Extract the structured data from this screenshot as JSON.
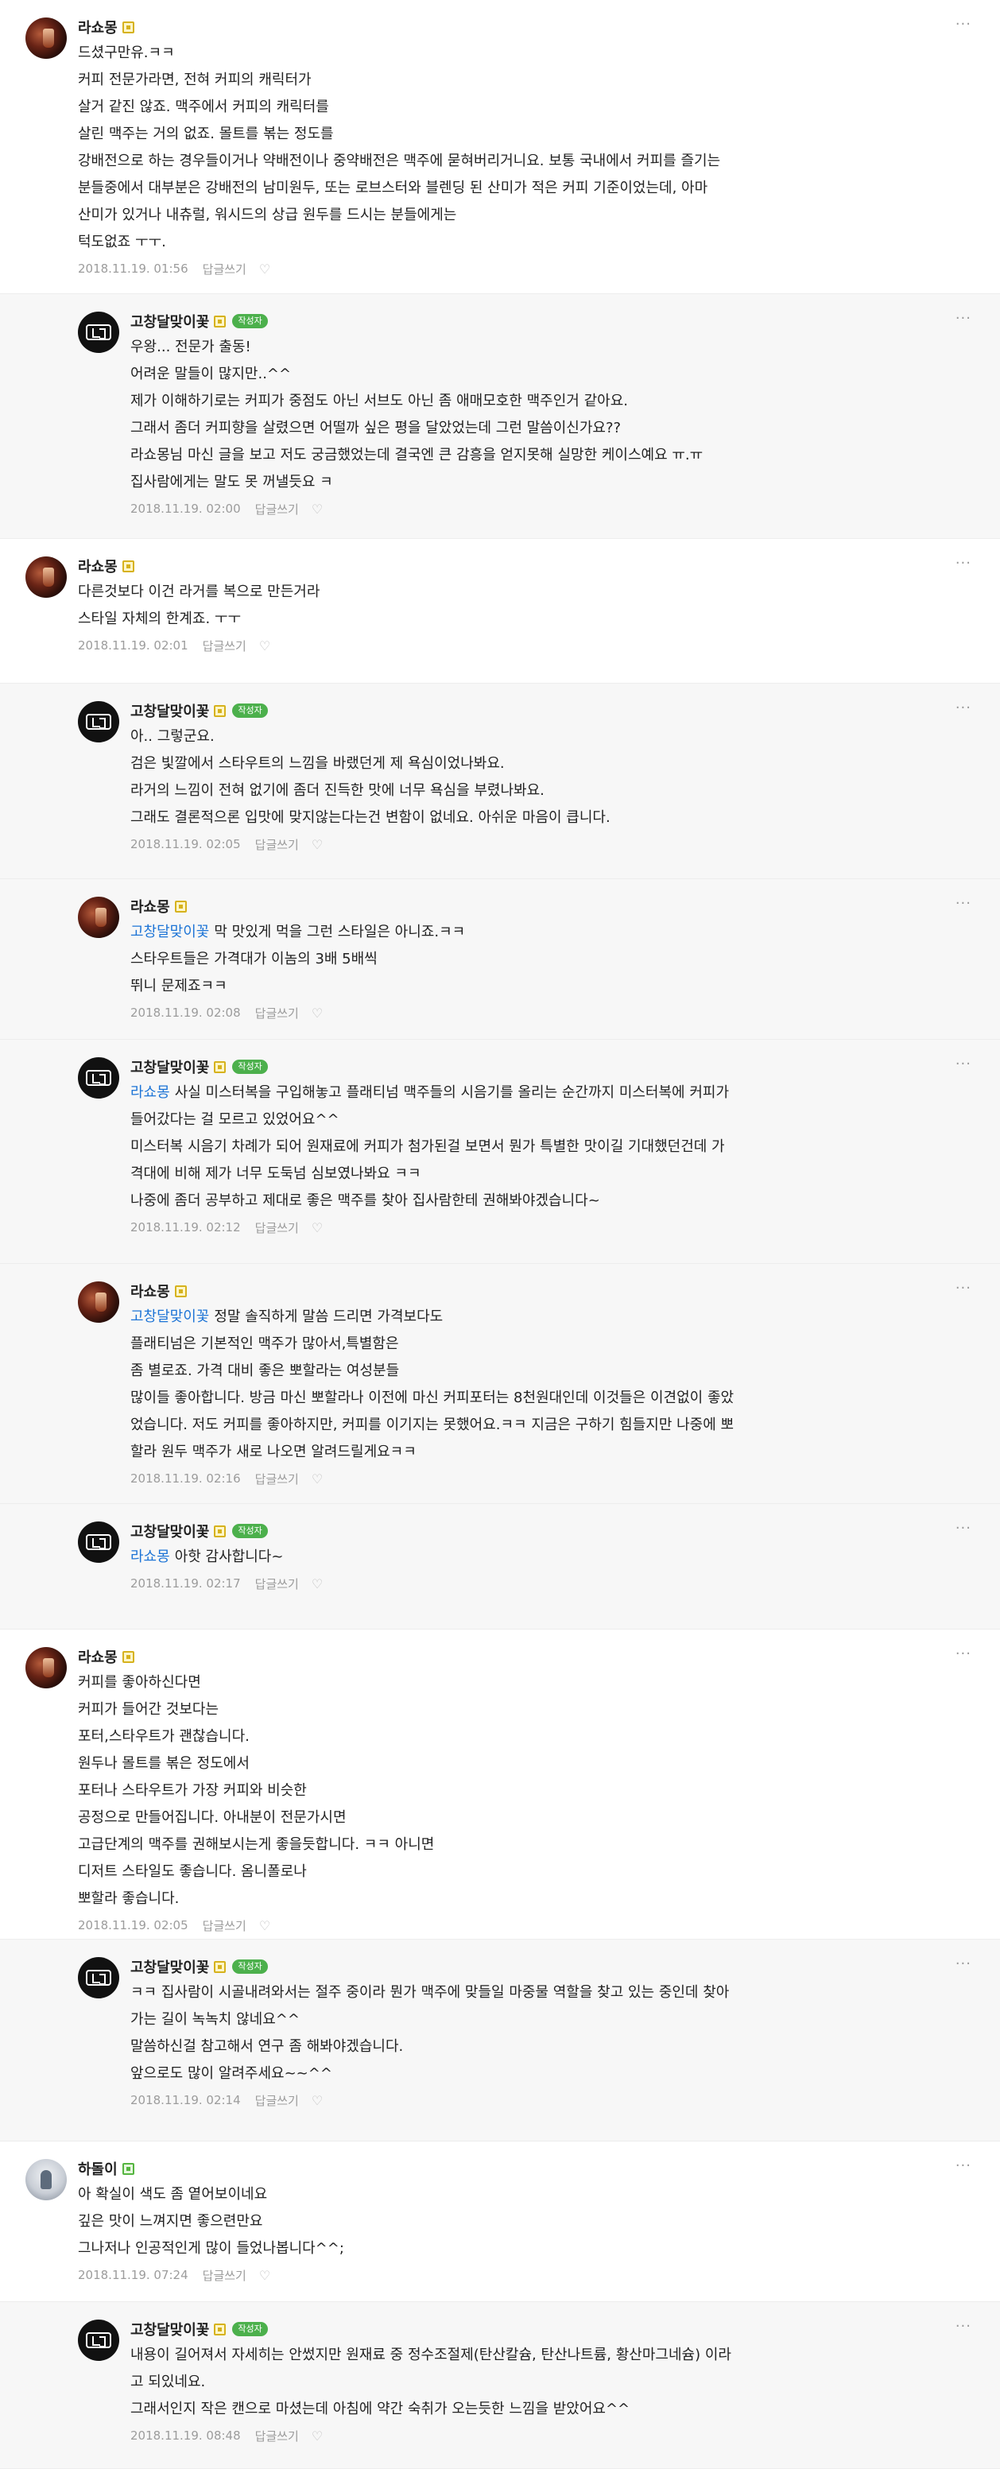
{
  "labels": {
    "reply": "답글쓰기",
    "author_badge": "작성자",
    "more": "···",
    "heart": "♡"
  },
  "comments": [
    {
      "avatar": "lasho",
      "nickname": "라쇼몽",
      "lines": [
        "드셨구만유.ㅋㅋ",
        "커피 전문가라면, 전혀 커피의 캐릭터가",
        "살거 같진 않죠. 맥주에서 커피의 캐릭터를",
        "살린 맥주는 거의 없죠. 몰트를 볶는 정도를",
        "강배전으로 하는 경우들이거나 약배전이나 중약배전은 맥주에 묻혀버리거니요. 보통 국내에서 커피를 즐기는",
        "분들중에서 대부분은 강배전의 남미원두, 또는 로브스터와 블렌딩 된 산미가 적은 커피 기준이었는데, 아마",
        "산미가 있거나 내츄럴, 워시드의 상급 원두를 드시는 분들에게는",
        "턱도없죠 ㅜㅜ."
      ],
      "date": "2018.11.19. 01:56"
    },
    {
      "avatar": "gosd",
      "nickname": "고창달맞이꽃",
      "is_author": true,
      "lines": [
        "우왕... 전문가 출동!",
        "어려운 말들이 많지만..^^",
        "제가 이해하기로는 커피가 중점도 아닌 서브도 아닌 좀 애매모호한 맥주인거 같아요.",
        "그래서 좀더 커피향을 살렸으면 어떨까 싶은 평을 달았었는데 그런 말씀이신가요??",
        "라쇼몽님 마신 글을 보고 저도 궁금했었는데 결국엔 큰 감흥을 얻지못해 실망한 케이스예요 ㅠ.ㅠ",
        "집사람에게는 말도 못 꺼낼듯요 ㅋ"
      ],
      "date": "2018.11.19. 02:00"
    },
    {
      "avatar": "lasho",
      "nickname": "라쇼몽",
      "lines": [
        "다른것보다 이건 라거를 복으로 만든거라",
        "스타일 자체의 한계죠. ㅜㅜ"
      ],
      "date": "2018.11.19. 02:01"
    },
    {
      "avatar": "gosd",
      "nickname": "고창달맞이꽃",
      "is_author": true,
      "lines": [
        "아.. 그렇군요.",
        "검은 빛깔에서 스타우트의 느낌을 바랬던게 제 욕심이었나봐요.",
        "라거의 느낌이 전혀 없기에 좀더 진득한 맛에 너무 욕심을 부렸나봐요.",
        "그래도 결론적으론 입맛에 맞지않는다는건 변함이 없네요. 아쉬운 마음이 큽니다."
      ],
      "date": "2018.11.19. 02:05"
    },
    {
      "avatar": "lasho",
      "nickname": "라쇼몽",
      "mention": "고창달맞이꽃",
      "lines": [
        "막 맛있게 먹을 그런 스타일은 아니죠.ㅋㅋ",
        "스타우트들은 가격대가 이놈의 3배 5배씩",
        "뛰니 문제죠ㅋㅋ"
      ],
      "date": "2018.11.19. 02:08"
    },
    {
      "avatar": "gosd",
      "nickname": "고창달맞이꽃",
      "is_author": true,
      "mention": "라쇼몽",
      "lines": [
        "사실 미스터복을 구입해놓고 플래티넘 맥주들의 시음기를 올리는 순간까지 미스터복에 커피가",
        "들어갔다는 걸 모르고 있었어요^^",
        "미스터복 시음기 차례가 되어 원재료에 커피가 첨가된걸 보면서 뭔가 특별한 맛이길 기대했던건데 가",
        "격대에 비해 제가 너무 도둑넘 심보였나봐요 ㅋㅋ",
        "나중에 좀더 공부하고 제대로 좋은 맥주를 찾아 집사람한테 권해봐야겠습니다~"
      ],
      "date": "2018.11.19. 02:12"
    },
    {
      "avatar": "lasho",
      "nickname": "라쇼몽",
      "mention": "고창달맞이꽃",
      "lines": [
        "정말 솔직하게 말씀 드리면 가격보다도",
        "플래티넘은 기본적인 맥주가 많아서,특별함은",
        "좀 별로죠. 가격 대비 좋은 뽀할라는 여성분들",
        "많이들 좋아합니다. 방금 마신 뽀할라나 이전에 마신 커피포터는 8천원대인데 이것들은 이견없이 좋았",
        "었습니다. 저도 커피를 좋아하지만, 커피를 이기지는 못했어요.ㅋㅋ 지금은 구하기 힘들지만 나중에 뽀",
        "할라 원두 맥주가 새로 나오면 알려드릴게요ㅋㅋ"
      ],
      "date": "2018.11.19. 02:16"
    },
    {
      "avatar": "gosd",
      "nickname": "고창달맞이꽃",
      "is_author": true,
      "mention": "라쇼몽",
      "lines": [
        "아핫 감사합니다~"
      ],
      "date": "2018.11.19. 02:17"
    },
    {
      "avatar": "lasho",
      "nickname": "라쇼몽",
      "lines": [
        "커피를 좋아하신다면",
        "커피가 들어간 것보다는",
        "포터,스타우트가 괜찮습니다.",
        "원두나 몰트를 볶은 정도에서",
        "포터나 스타우트가 가장 커피와 비슷한",
        "공정으로 만들어집니다. 아내분이 전문가시면",
        "고급단계의 맥주를 권해보시는게 좋을듯합니다. ㅋㅋ 아니면",
        "디저트 스타일도 좋습니다. 옴니폴로나",
        "뽀할라 좋습니다."
      ],
      "date": "2018.11.19. 02:05"
    },
    {
      "avatar": "gosd",
      "nickname": "고창달맞이꽃",
      "is_author": true,
      "lines": [
        "ㅋㅋ 집사람이 시골내려와서는 절주 중이라 뭔가 맥주에 맞들일 마중물 역할을 찾고 있는 중인데 찾아",
        "가는 길이 녹녹치 않네요^^",
        "말씀하신걸 참고해서 연구 좀 해봐야겠습니다.",
        "앞으로도 많이 알려주세요~~^^"
      ],
      "date": "2018.11.19. 02:14"
    },
    {
      "avatar": "hadol",
      "nickname": "하돌이",
      "level_color": "green",
      "lines": [
        "아 확실이 색도 좀 옅어보이네요",
        "깊은 맛이 느껴지면 좋으련만요",
        "그나저나 인공적인게 많이 들었나봅니다^^;"
      ],
      "date": "2018.11.19. 07:24"
    },
    {
      "avatar": "gosd",
      "nickname": "고창달맞이꽃",
      "is_author": true,
      "lines": [
        "내용이 길어져서 자세히는 안썼지만 원재료 중 정수조절제(탄산칼슘, 탄산나트륨, 황산마그네슘) 이라",
        "고 되있네요.",
        "그래서인지 작은 캔으로 마셨는데 아침에 약간 숙취가 오는듯한 느낌을 받았어요^^"
      ],
      "date": "2018.11.19. 08:48"
    }
  ]
}
